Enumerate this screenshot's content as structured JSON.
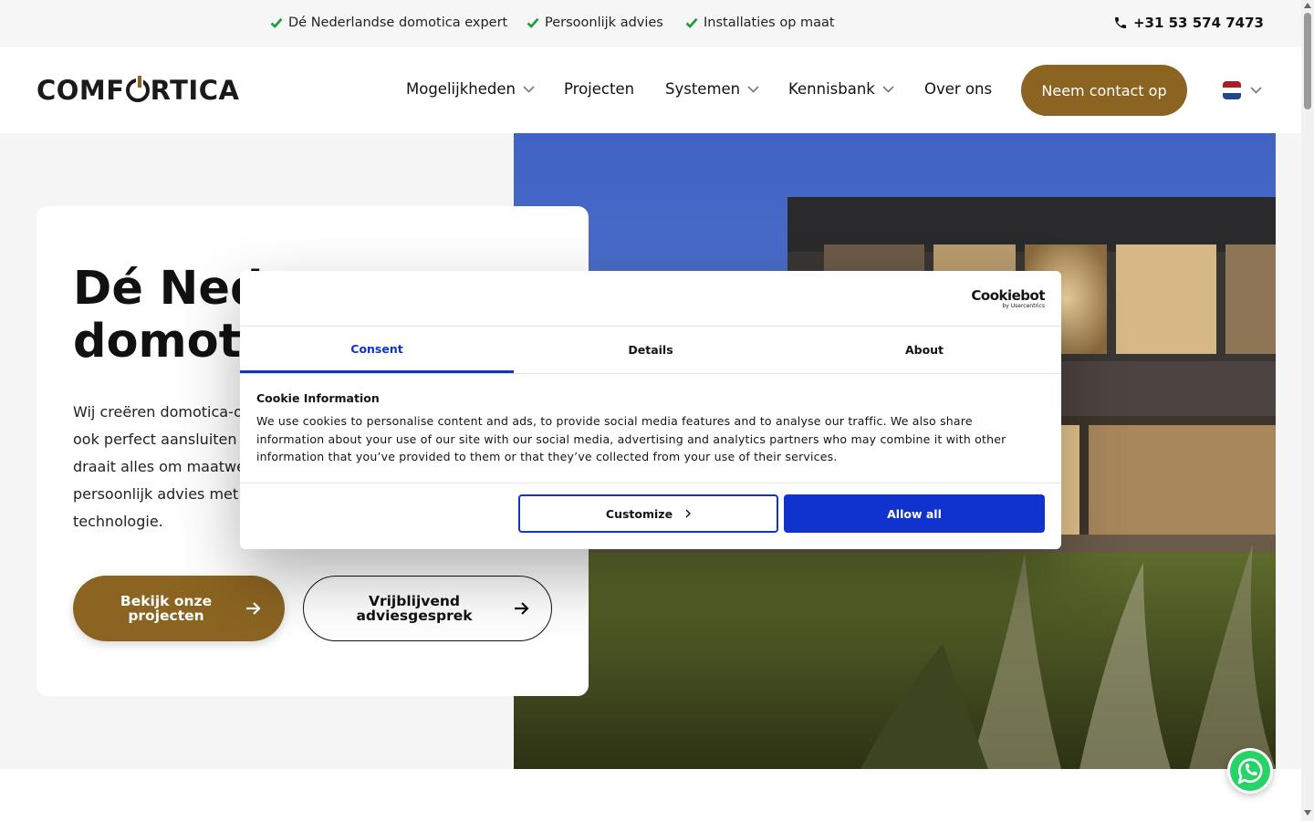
{
  "topbar": {
    "usps": [
      "Dé Nederlandse domotica expert",
      "Persoonlijk advies",
      "Installaties op maat"
    ],
    "phone": "+31 53 574 7473"
  },
  "header": {
    "logo": {
      "before": "COMF",
      "after": "RTICA"
    },
    "nav": [
      {
        "label": "Mogelijkheden",
        "has_dropdown": true
      },
      {
        "label": "Projecten",
        "has_dropdown": false
      },
      {
        "label": "Systemen",
        "has_dropdown": true
      },
      {
        "label": "Kennisbank",
        "has_dropdown": true
      },
      {
        "label": "Over ons",
        "has_dropdown": false
      }
    ],
    "cta": "Neem contact op",
    "language_icon": "flag-nl-icon"
  },
  "hero": {
    "title_line1": "Dé Ned",
    "title_line2": "domoti",
    "text_lines": [
      "Wij creëren domotica-o",
      "ook perfect aansluiten",
      "draait alles om maatwe",
      "persoonlijk advies met",
      "technologie."
    ],
    "primary_button": {
      "line1": "Bekijk onze",
      "line2": "projecten"
    },
    "secondary_button": {
      "line1": "Vrijblijvend",
      "line2": "adviesgesprek"
    }
  },
  "cookie": {
    "brand": "Cookiebot",
    "brand_sub": "by Usercentrics",
    "tabs": [
      {
        "label": "Consent",
        "active": true
      },
      {
        "label": "Details",
        "active": false
      },
      {
        "label": "About",
        "active": false
      }
    ],
    "heading": "Cookie Information",
    "body": "We use cookies to personalise content and ads, to provide social media features and to analyse our traffic. We also share information about your use of our site with our social media, advertising and analytics partners who may combine it with other information that you’ve provided to them or that they’ve collected from your use of their services.",
    "customize_label": "Customize",
    "allow_all_label": "Allow all"
  },
  "colors": {
    "brand_gold": "#8b6421",
    "cookie_blue": "#1032cf",
    "check_green": "#1a9c3e"
  }
}
